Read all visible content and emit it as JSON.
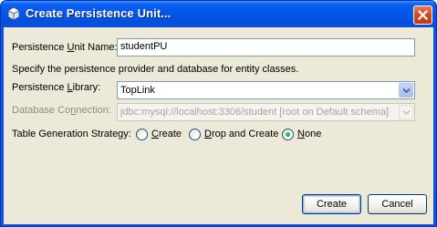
{
  "window": {
    "title": "Create Persistence Unit..."
  },
  "form": {
    "unit_name": {
      "label_pre": "Persistence ",
      "label_mnemonic": "U",
      "label_post": "nit Name:",
      "value": "studentPU"
    },
    "description": "Specify the persistence provider and database for entity classes.",
    "library": {
      "label_pre": "Persistence ",
      "label_mnemonic": "L",
      "label_post": "ibrary:",
      "value": "TopLink"
    },
    "connection": {
      "label_pre": "Database Co",
      "label_mnemonic": "n",
      "label_post": "nection:",
      "value": "jdbc:mysql://localhost:3306/student [root on Default schema]"
    },
    "strategy": {
      "label": "Table Generation Strategy:",
      "options": [
        {
          "pre": "",
          "mnemonic": "C",
          "post": "reate",
          "selected": false
        },
        {
          "pre": "",
          "mnemonic": "D",
          "post": "rop and Create",
          "selected": false
        },
        {
          "pre": "",
          "mnemonic": "N",
          "post": "one",
          "selected": true
        }
      ]
    }
  },
  "buttons": {
    "create": "Create",
    "cancel": "Cancel"
  },
  "colors": {
    "titlebar": "#0556e8",
    "client": "#ece9d8",
    "close": "#d4471f",
    "field_border": "#7f9db9"
  }
}
